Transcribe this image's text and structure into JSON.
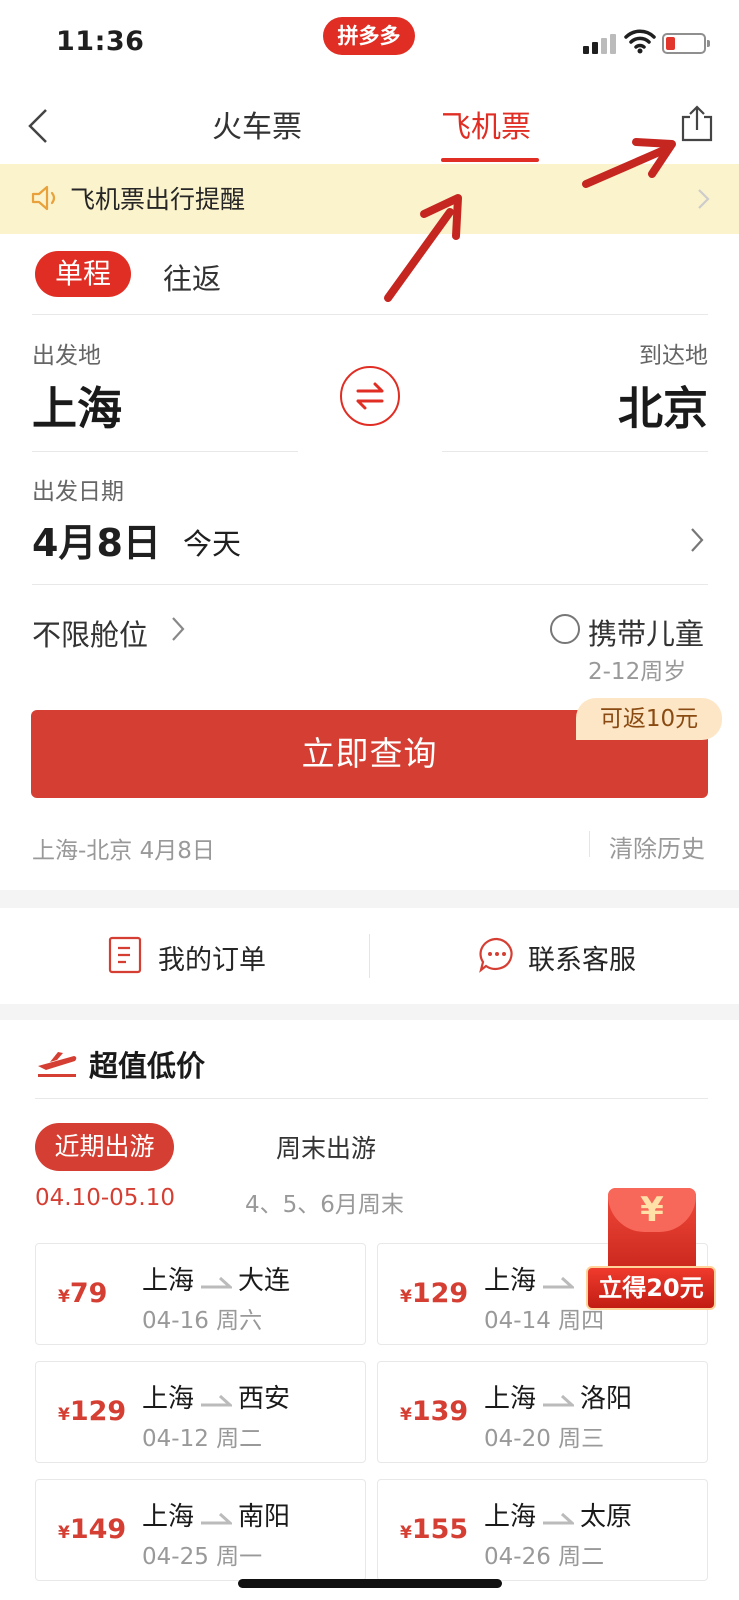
{
  "status_bar": {
    "time": "11:36",
    "app_badge": "拼多多"
  },
  "nav": {
    "tabs": [
      {
        "label": "火车票"
      },
      {
        "label": "飞机票"
      }
    ],
    "active_tab": "飞机票"
  },
  "notice": {
    "text": "飞机票出行提醒"
  },
  "trip_type": {
    "one_way": "单程",
    "round_trip": "往返"
  },
  "route": {
    "from_label": "出发地",
    "from_city": "上海",
    "to_label": "到达地",
    "to_city": "北京"
  },
  "date": {
    "label": "出发日期",
    "value": "4月8日",
    "relative": "今天"
  },
  "cabin": {
    "label": "不限舱位"
  },
  "child": {
    "label": "携带儿童",
    "age": "2-12周岁"
  },
  "search": {
    "button": "立即查询",
    "rebate": "可返10元"
  },
  "history": {
    "entry": "上海-北京 4月8日",
    "clear": "清除历史"
  },
  "shortcuts": {
    "orders": "我的订单",
    "service": "联系客服"
  },
  "deals": {
    "title": "超值低价",
    "tabs": [
      {
        "label": "近期出游",
        "range": "04.10-05.10"
      },
      {
        "label": "周末出游",
        "range": "4、5、6月周末"
      }
    ],
    "cards": [
      {
        "currency": "¥",
        "price": "79",
        "from": "上海",
        "to": "大连",
        "date": "04-16 周六"
      },
      {
        "currency": "¥",
        "price": "129",
        "from": "上海",
        "to": "",
        "date": "04-14 周四"
      },
      {
        "currency": "¥",
        "price": "129",
        "from": "上海",
        "to": "西安",
        "date": "04-12 周二"
      },
      {
        "currency": "¥",
        "price": "139",
        "from": "上海",
        "to": "洛阳",
        "date": "04-20 周三"
      },
      {
        "currency": "¥",
        "price": "149",
        "from": "上海",
        "to": "南阳",
        "date": "04-25 周一"
      },
      {
        "currency": "¥",
        "price": "155",
        "from": "上海",
        "to": "太原",
        "date": "04-26 周二"
      }
    ]
  },
  "red_packet": {
    "symbol": "¥",
    "label": "立得20元"
  },
  "colors": {
    "accent": "#e02e24",
    "button": "#d53f33",
    "notice_bg": "#fbf3cc"
  }
}
